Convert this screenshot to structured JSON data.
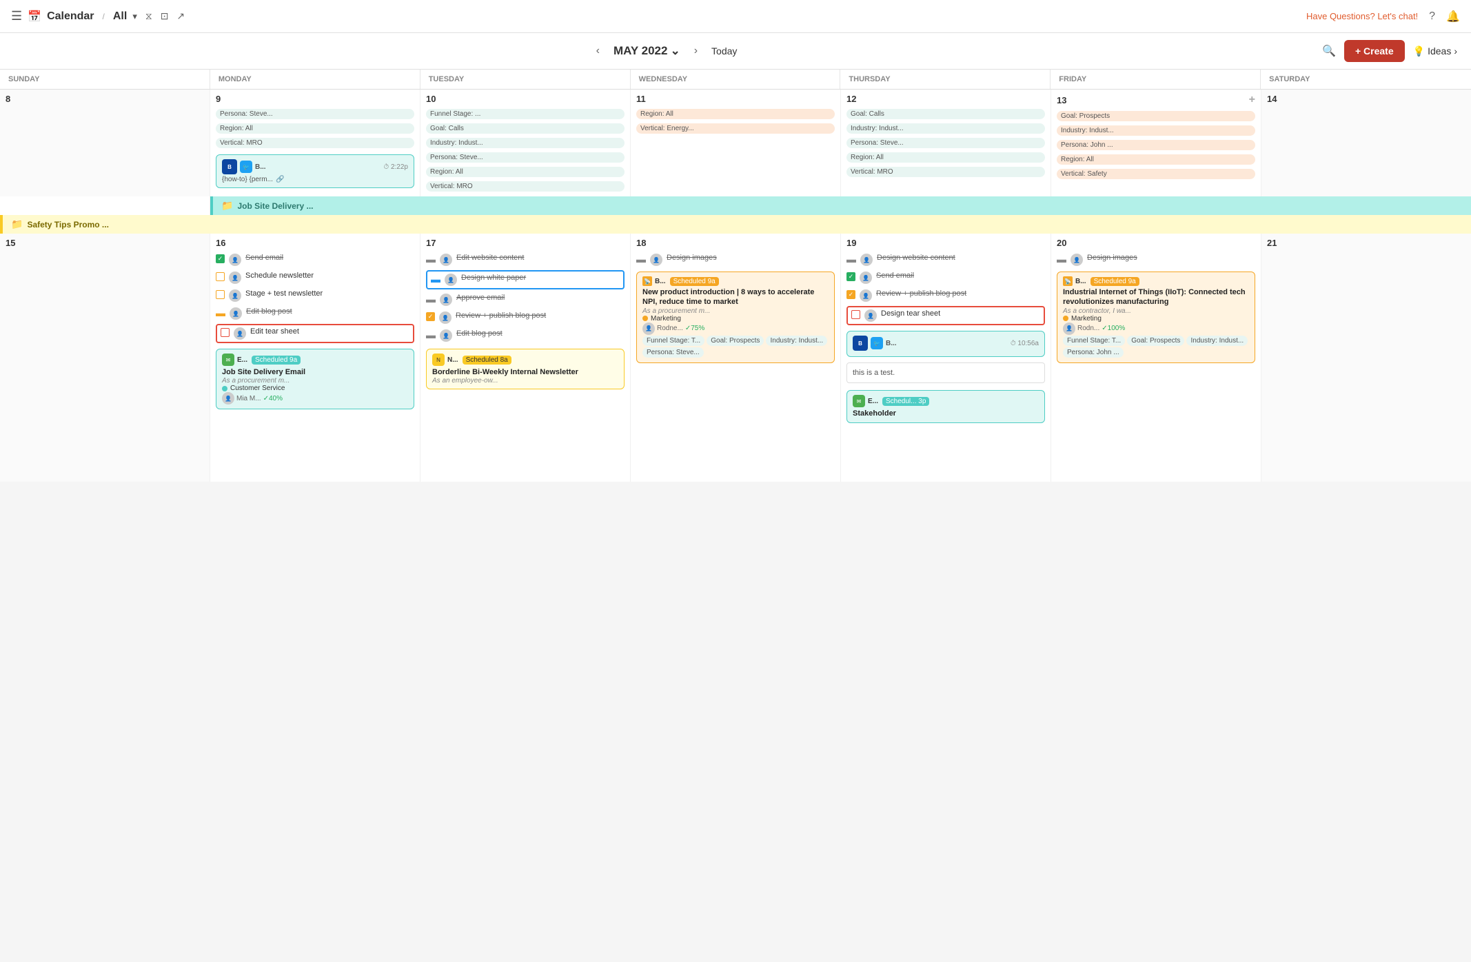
{
  "nav": {
    "menu_icon": "☰",
    "calendar_icon": "📅",
    "title": "Calendar",
    "slash": "/",
    "all": "All",
    "filter_icon": "▾",
    "filter": "⧖",
    "display": "⊡",
    "share": "↗",
    "chat": "Have Questions? Let's chat!",
    "help": "?",
    "bell": "🔔"
  },
  "toolbar": {
    "prev": "‹",
    "next": "›",
    "month": "MAY 2022",
    "dropdown": "⌄",
    "today": "Today",
    "search": "🔍",
    "create": "+ Create",
    "ideas": "Ideas",
    "bulb": "💡"
  },
  "days": [
    "SUNDAY",
    "MONDAY",
    "TUESDAY",
    "WEDNESDAY",
    "THURSDAY",
    "FRIDAY",
    "SATURDAY"
  ],
  "week1": {
    "dates": [
      "8",
      "9",
      "10",
      "11",
      "12",
      "13",
      "14"
    ],
    "mon_tags": [
      "Persona: Steve...",
      "Region: All",
      "Vertical: MRO"
    ],
    "tue_tags": [
      "Funnel Stage: ...",
      "Goal: Calls",
      "Industry: Indust...",
      "Persona: Steve...",
      "Region: All",
      "Vertical: MRO"
    ],
    "wed_tags": [
      "Region: All",
      "Vertical: Energy..."
    ],
    "thu_tags": [
      "Goal: Calls",
      "Industry: Indust...",
      "Persona: Steve...",
      "Region: All",
      "Vertical: MRO"
    ],
    "fri_tags": [
      "Goal: Prospects",
      "Industry: Indust...",
      "Persona: John ...",
      "Region: All",
      "Vertical: Safety"
    ],
    "mon_card": {
      "blog_label": "B...",
      "time": "⏱ 2:22p",
      "link_text": "{how-to} {perm...",
      "link_icon": "🔗"
    }
  },
  "banner1": {
    "icon": "📁",
    "text": "Job Site Delivery ..."
  },
  "banner2": {
    "icon": "📁",
    "text": "Safety Tips Promo ..."
  },
  "week2": {
    "dates": [
      "15",
      "16",
      "17",
      "18",
      "19",
      "20",
      "21"
    ],
    "sun_date": "15",
    "mon": {
      "tasks": [
        {
          "checked": true,
          "text": "Send email",
          "strikethrough": true
        },
        {
          "checked": false,
          "outline": "yellow",
          "text": "Schedule newsletter"
        },
        {
          "checked": false,
          "outline": "yellow",
          "text": "Stage + test newsletter"
        },
        {
          "checked": false,
          "minus": true,
          "text": "Edit blog post",
          "strikethrough": true
        },
        {
          "checked": false,
          "red": true,
          "text": "Edit tear sheet"
        }
      ],
      "scheduled_label": "E...",
      "scheduled_time": "Scheduled 9a",
      "card_title": "Job Site Delivery Email",
      "card_desc": "As a procurement m...",
      "card_dot": "teal",
      "card_dot_label": "Customer Service",
      "card_author": "Mia M...",
      "card_progress": "✓40%"
    },
    "tue": {
      "tasks": [
        {
          "strikethrough": true,
          "text": "Edit website content"
        },
        {
          "blue_outline": true,
          "strikethrough": true,
          "text": "Design white paper"
        },
        {
          "strikethrough": true,
          "text": "Approve email"
        },
        {
          "checked": true,
          "text": "Review + publish blog post"
        },
        {
          "minus": true,
          "strikethrough": true,
          "text": "Edit blog post"
        }
      ],
      "scheduled_label": "N...",
      "scheduled_time": "Scheduled 8a",
      "card_title": "Borderline Bi-Weekly Internal Newsletter",
      "card_desc": "As an employee-ow..."
    },
    "wed": {
      "tasks": [
        {
          "minus": true,
          "strikethrough": true,
          "text": "Design images"
        }
      ],
      "scheduled_label": "B...",
      "scheduled_time": "Scheduled 9a",
      "card_title": "New product introduction | 8 ways to accelerate NPI, reduce time to market",
      "card_desc": "As a procurement m...",
      "card_dot": "orange",
      "card_dot_label": "Marketing",
      "card_author": "Rodne...",
      "card_progress": "✓75%",
      "tags": [
        "Funnel Stage: T...",
        "Goal: Prospects",
        "Industry: Indust...",
        "Persona: Steve..."
      ]
    },
    "thu": {
      "tasks": [
        {
          "minus": true,
          "strikethrough": true,
          "text": "Design website content"
        },
        {
          "checked": true,
          "text": "Send email"
        },
        {
          "checked_orange": true,
          "text": "Review + publish blog post"
        },
        {
          "red_outline": true,
          "text": "Design tear sheet"
        }
      ],
      "blog_label": "B",
      "twitter_label": "🐦",
      "time": "⏱ 10:56a",
      "test_text": "this is a test.",
      "scheduled_label": "E...",
      "scheduled_time": "Schedul... 3p",
      "bottom_card": "Stakeholder"
    },
    "fri": {
      "tasks": [
        {
          "minus": true,
          "strikethrough": true,
          "text": "Design images"
        }
      ],
      "scheduled_label": "B...",
      "scheduled_time": "Scheduled 9a",
      "card_title": "Industrial Internet of Things (IIoT): Connected tech revolutionizes manufacturing",
      "card_desc": "As a contractor, I wa...",
      "card_dot": "orange",
      "card_dot_label": "Marketing",
      "card_author": "Rodn...",
      "card_progress": "✓100%",
      "tags": [
        "Funnel Stage: T...",
        "Goal: Prospects",
        "Industry: Indust...",
        "Persona: John ..."
      ]
    },
    "sat": {
      "date": "21"
    }
  }
}
